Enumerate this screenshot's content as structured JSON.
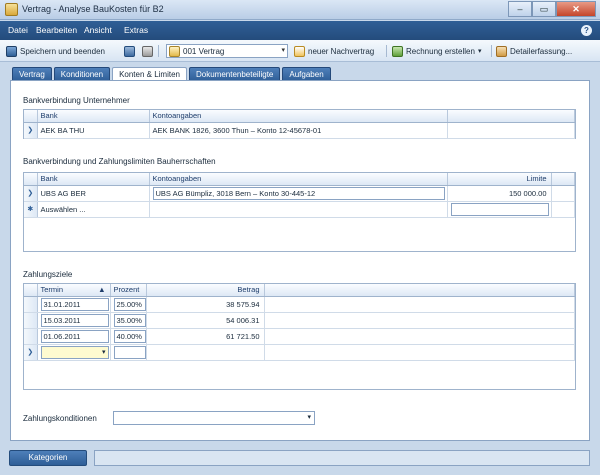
{
  "window": {
    "title": "Vertrag - Analyse BauKosten für B2",
    "min": "–",
    "max": "▭",
    "close": "✕"
  },
  "menu": [
    "Datei",
    "Bearbeiten",
    "Ansicht",
    "Extras"
  ],
  "toolbar": {
    "save_close": "Speichern und beenden",
    "contract_select": "001 Vertrag",
    "new_supplement": "neuer Nachvertrag",
    "create_invoice": "Rechnung erstellen",
    "detail_entry": "Detailerfassung..."
  },
  "tabs": [
    {
      "label": "Vertrag",
      "active": false
    },
    {
      "label": "Konditionen",
      "active": false
    },
    {
      "label": "Konten & Limiten",
      "active": true
    },
    {
      "label": "Dokumentenbeteiligte",
      "active": false
    },
    {
      "label": "Aufgaben",
      "active": false
    }
  ],
  "bank_contractor": {
    "label": "Bankverbindung Unternehmer",
    "columns": [
      "Bank",
      "Kontoangaben"
    ],
    "rows": [
      {
        "bank": "AEK BA THU",
        "account": "AEK BANK 1826, 3600 Thun – Konto 12-45678-01"
      }
    ]
  },
  "bank_owner": {
    "label": "Bankverbindung und Zahlungslimiten Bauherrschaften",
    "columns": [
      "Bank",
      "Kontoangaben",
      "Limite"
    ],
    "rows": [
      {
        "bank": "UBS AG BER",
        "account": "UBS AG Bümpliz, 3018 Bern – Konto 30-445-12",
        "limit": "150 000.00"
      }
    ],
    "new_row": "Auswählen ..."
  },
  "payment_targets": {
    "label": "Zahlungsziele",
    "columns": [
      "Termin",
      "Prozent",
      "Betrag"
    ],
    "rows": [
      {
        "date": "31.01.2011",
        "percent": "25.00%",
        "amount": "38 575.94"
      },
      {
        "date": "15.03.2011",
        "percent": "35.00%",
        "amount": "54 006.31"
      },
      {
        "date": "01.06.2011",
        "percent": "40.00%",
        "amount": "61 721.50"
      }
    ]
  },
  "payment_conditions": {
    "label": "Zahlungskonditionen",
    "value": ""
  },
  "bottom": {
    "categories_button": "Kategorien"
  },
  "colors": {
    "menu_bg": "#2f5f96",
    "tab_bg": "#2e5e97",
    "accent": "#1e3d6b"
  }
}
